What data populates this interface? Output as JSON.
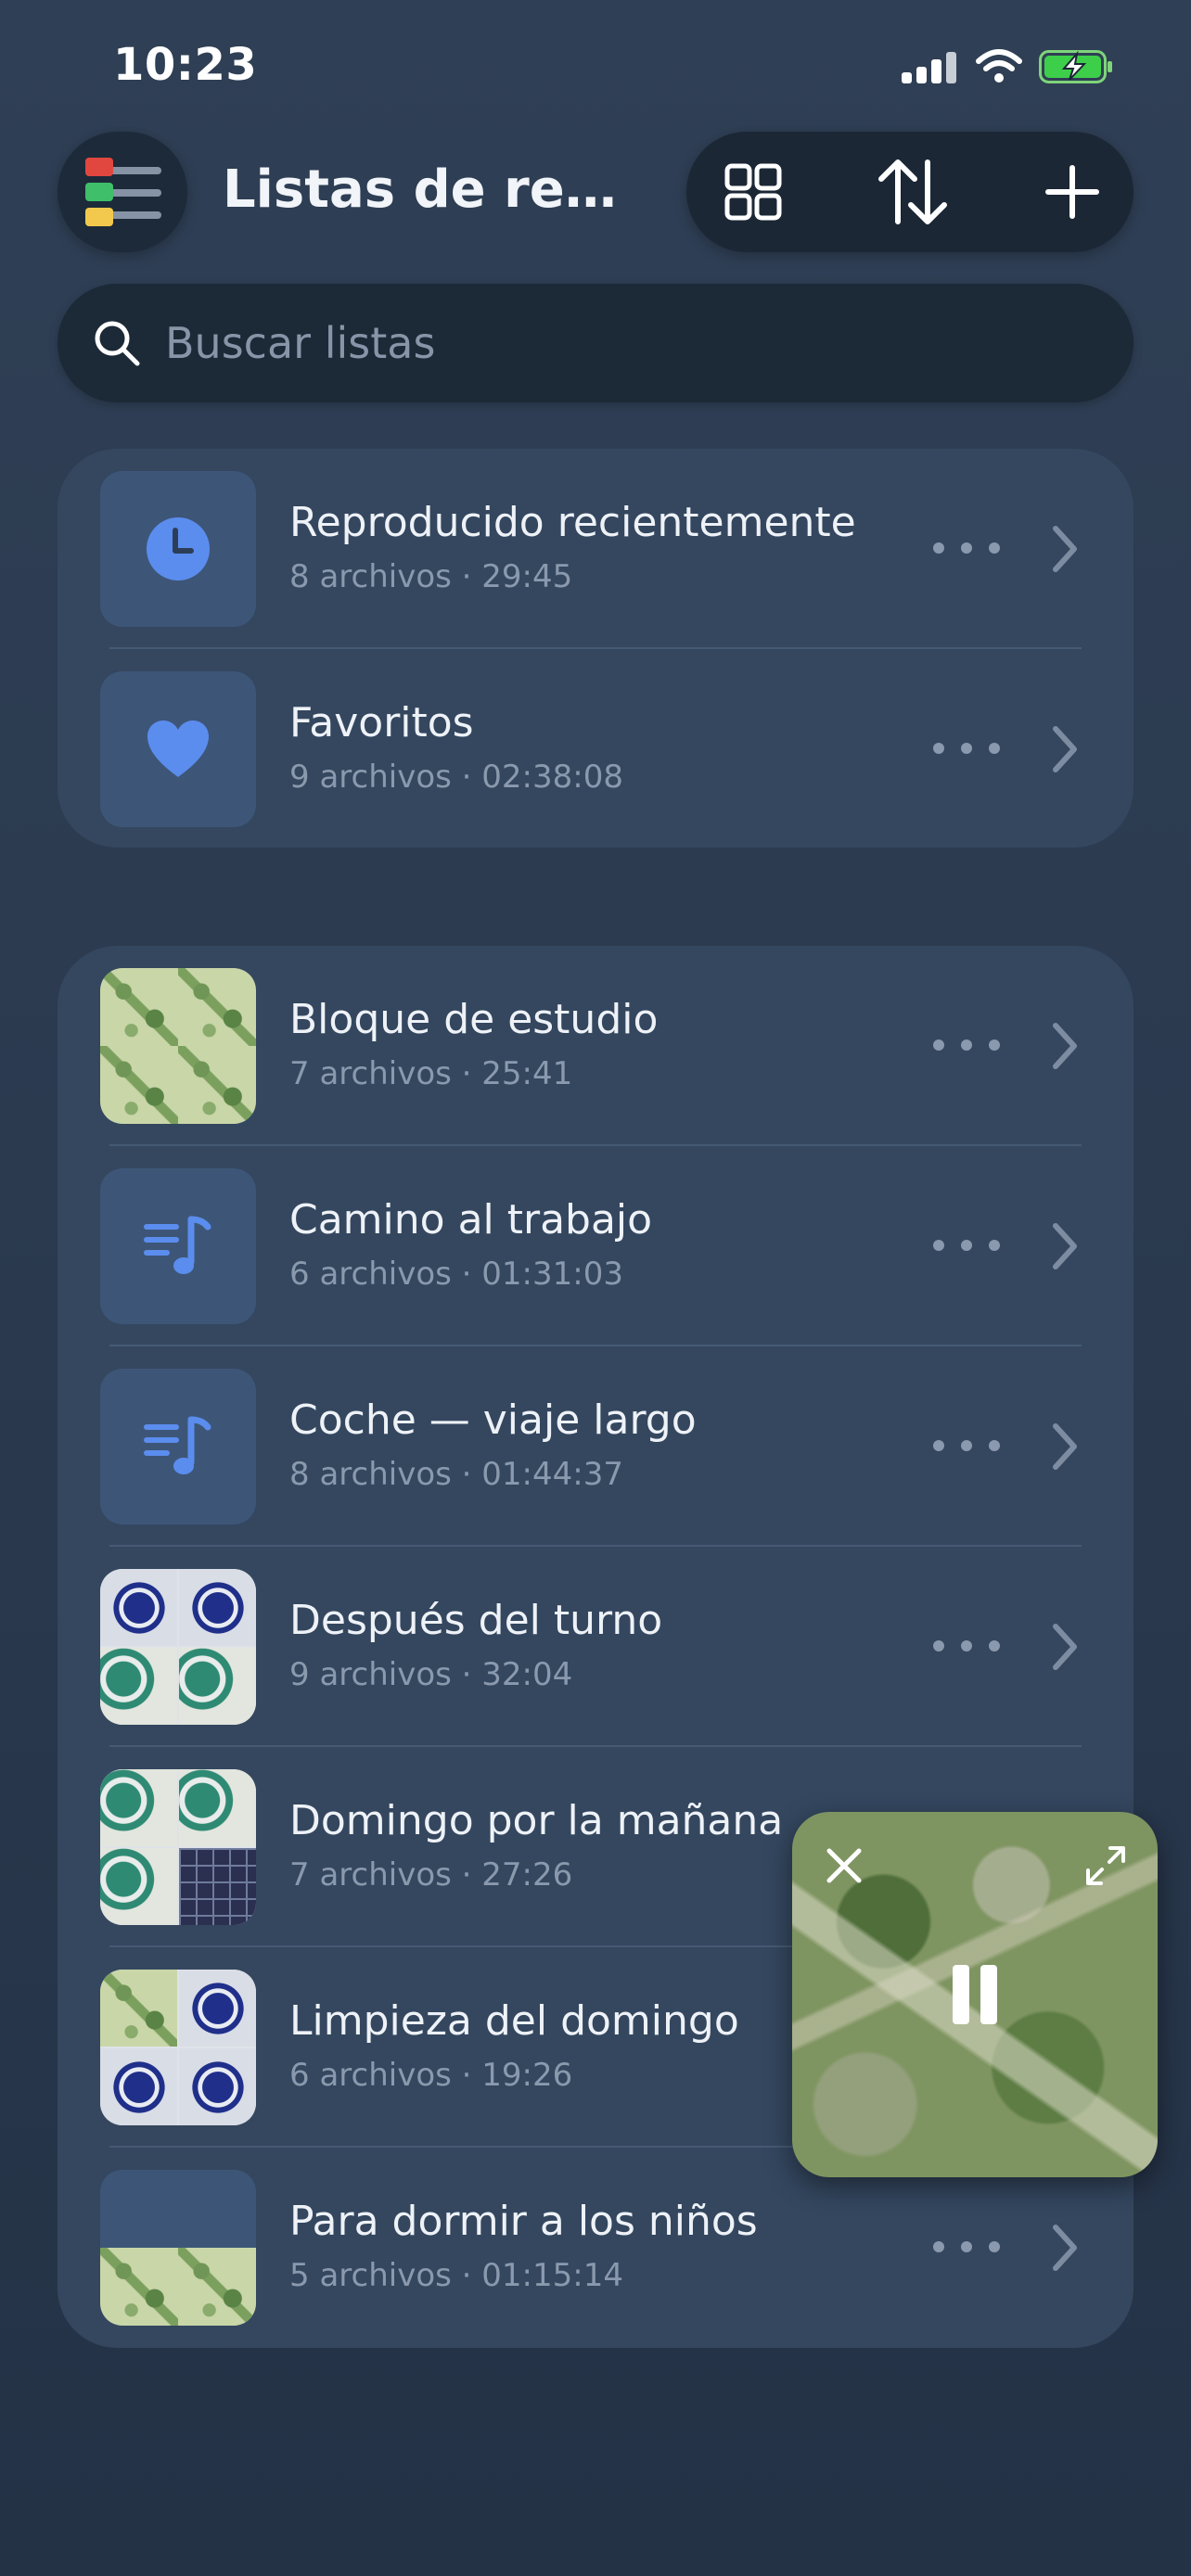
{
  "status_bar": {
    "time": "10:23"
  },
  "header": {
    "title": "Listas de repro...",
    "actions": [
      "grid-view",
      "sort",
      "add"
    ]
  },
  "search": {
    "placeholder": "Buscar listas",
    "value": ""
  },
  "pinned": [
    {
      "title": "Reproducido recientemente",
      "subtitle": "8 archivos · 29:45",
      "icon": "clock-icon"
    },
    {
      "title": "Favoritos",
      "subtitle": "9 archivos · 02:38:08",
      "icon": "heart-icon"
    }
  ],
  "playlists": [
    {
      "title": "Bloque de estudio",
      "subtitle": "7 archivos · 25:41",
      "artwork": "leaf-pattern"
    },
    {
      "title": "Camino al trabajo",
      "subtitle": "6 archivos · 01:31:03",
      "artwork": "playlist-icon"
    },
    {
      "title": "Coche — viaje largo",
      "subtitle": "8 archivos · 01:44:37",
      "artwork": "playlist-icon"
    },
    {
      "title": "Después del turno",
      "subtitle": "9 archivos · 32:04",
      "artwork": "wave-collage"
    },
    {
      "title": "Domingo por la mañana",
      "subtitle": "7 archivos · 27:26",
      "artwork": "wave-collage"
    },
    {
      "title": "Limpieza del domingo",
      "subtitle": "6 archivos · 19:26",
      "artwork": "leaf-wave-collage"
    },
    {
      "title": "Para dormir a los niños",
      "subtitle": "5 archivos · 01:15:14",
      "artwork": "leaf-partial"
    }
  ],
  "mini_player": {
    "state": "playing",
    "controls": [
      "close",
      "expand",
      "pause"
    ]
  },
  "colors": {
    "background": "#2f3f55",
    "card": "#34475f",
    "accent": "#5b8dee",
    "secondary_text": "#8a99ad"
  }
}
